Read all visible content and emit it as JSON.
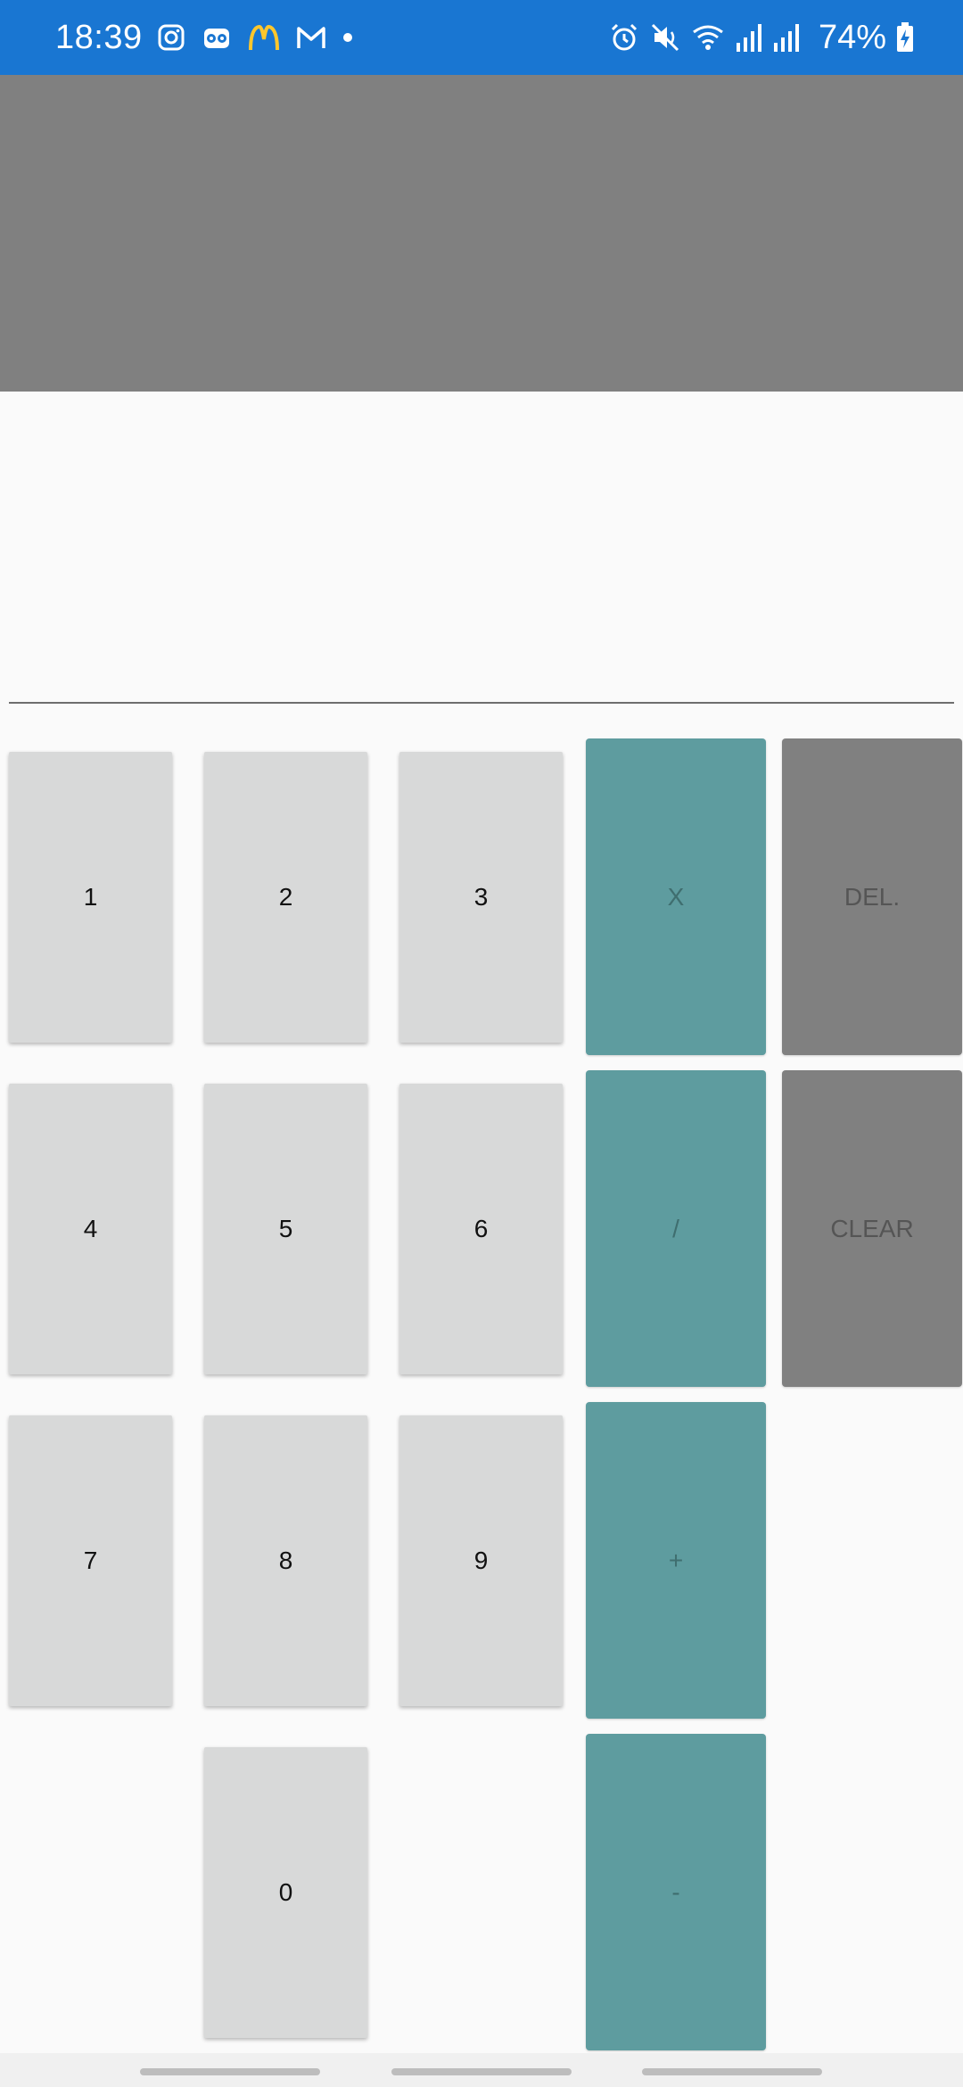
{
  "status_bar": {
    "time": "18:39",
    "battery": "74%",
    "background": "#1976D2",
    "left_icons": [
      "instagram-icon",
      "tripadvisor-icon",
      "mcdonalds-icon",
      "gmail-icon",
      "dot-icon"
    ],
    "right_icons": [
      "alarm-icon",
      "mute-icon",
      "wifi-icon",
      "signal-icon",
      "signal-icon",
      "battery-charging-icon"
    ]
  },
  "display": {
    "result": "",
    "expression": ""
  },
  "keypad": {
    "digits": [
      "1",
      "2",
      "3",
      "4",
      "5",
      "6",
      "7",
      "8",
      "9",
      "0"
    ],
    "operators": {
      "multiply": "X",
      "divide": "/",
      "add": "+",
      "subtract": "-"
    },
    "functions": {
      "delete": "DEL.",
      "clear": "CLEAR"
    }
  },
  "colors": {
    "number_key": "#D8D9D9",
    "operator_key": "#5E9C9F",
    "function_key": "#808080",
    "display_panel": "#808080"
  }
}
